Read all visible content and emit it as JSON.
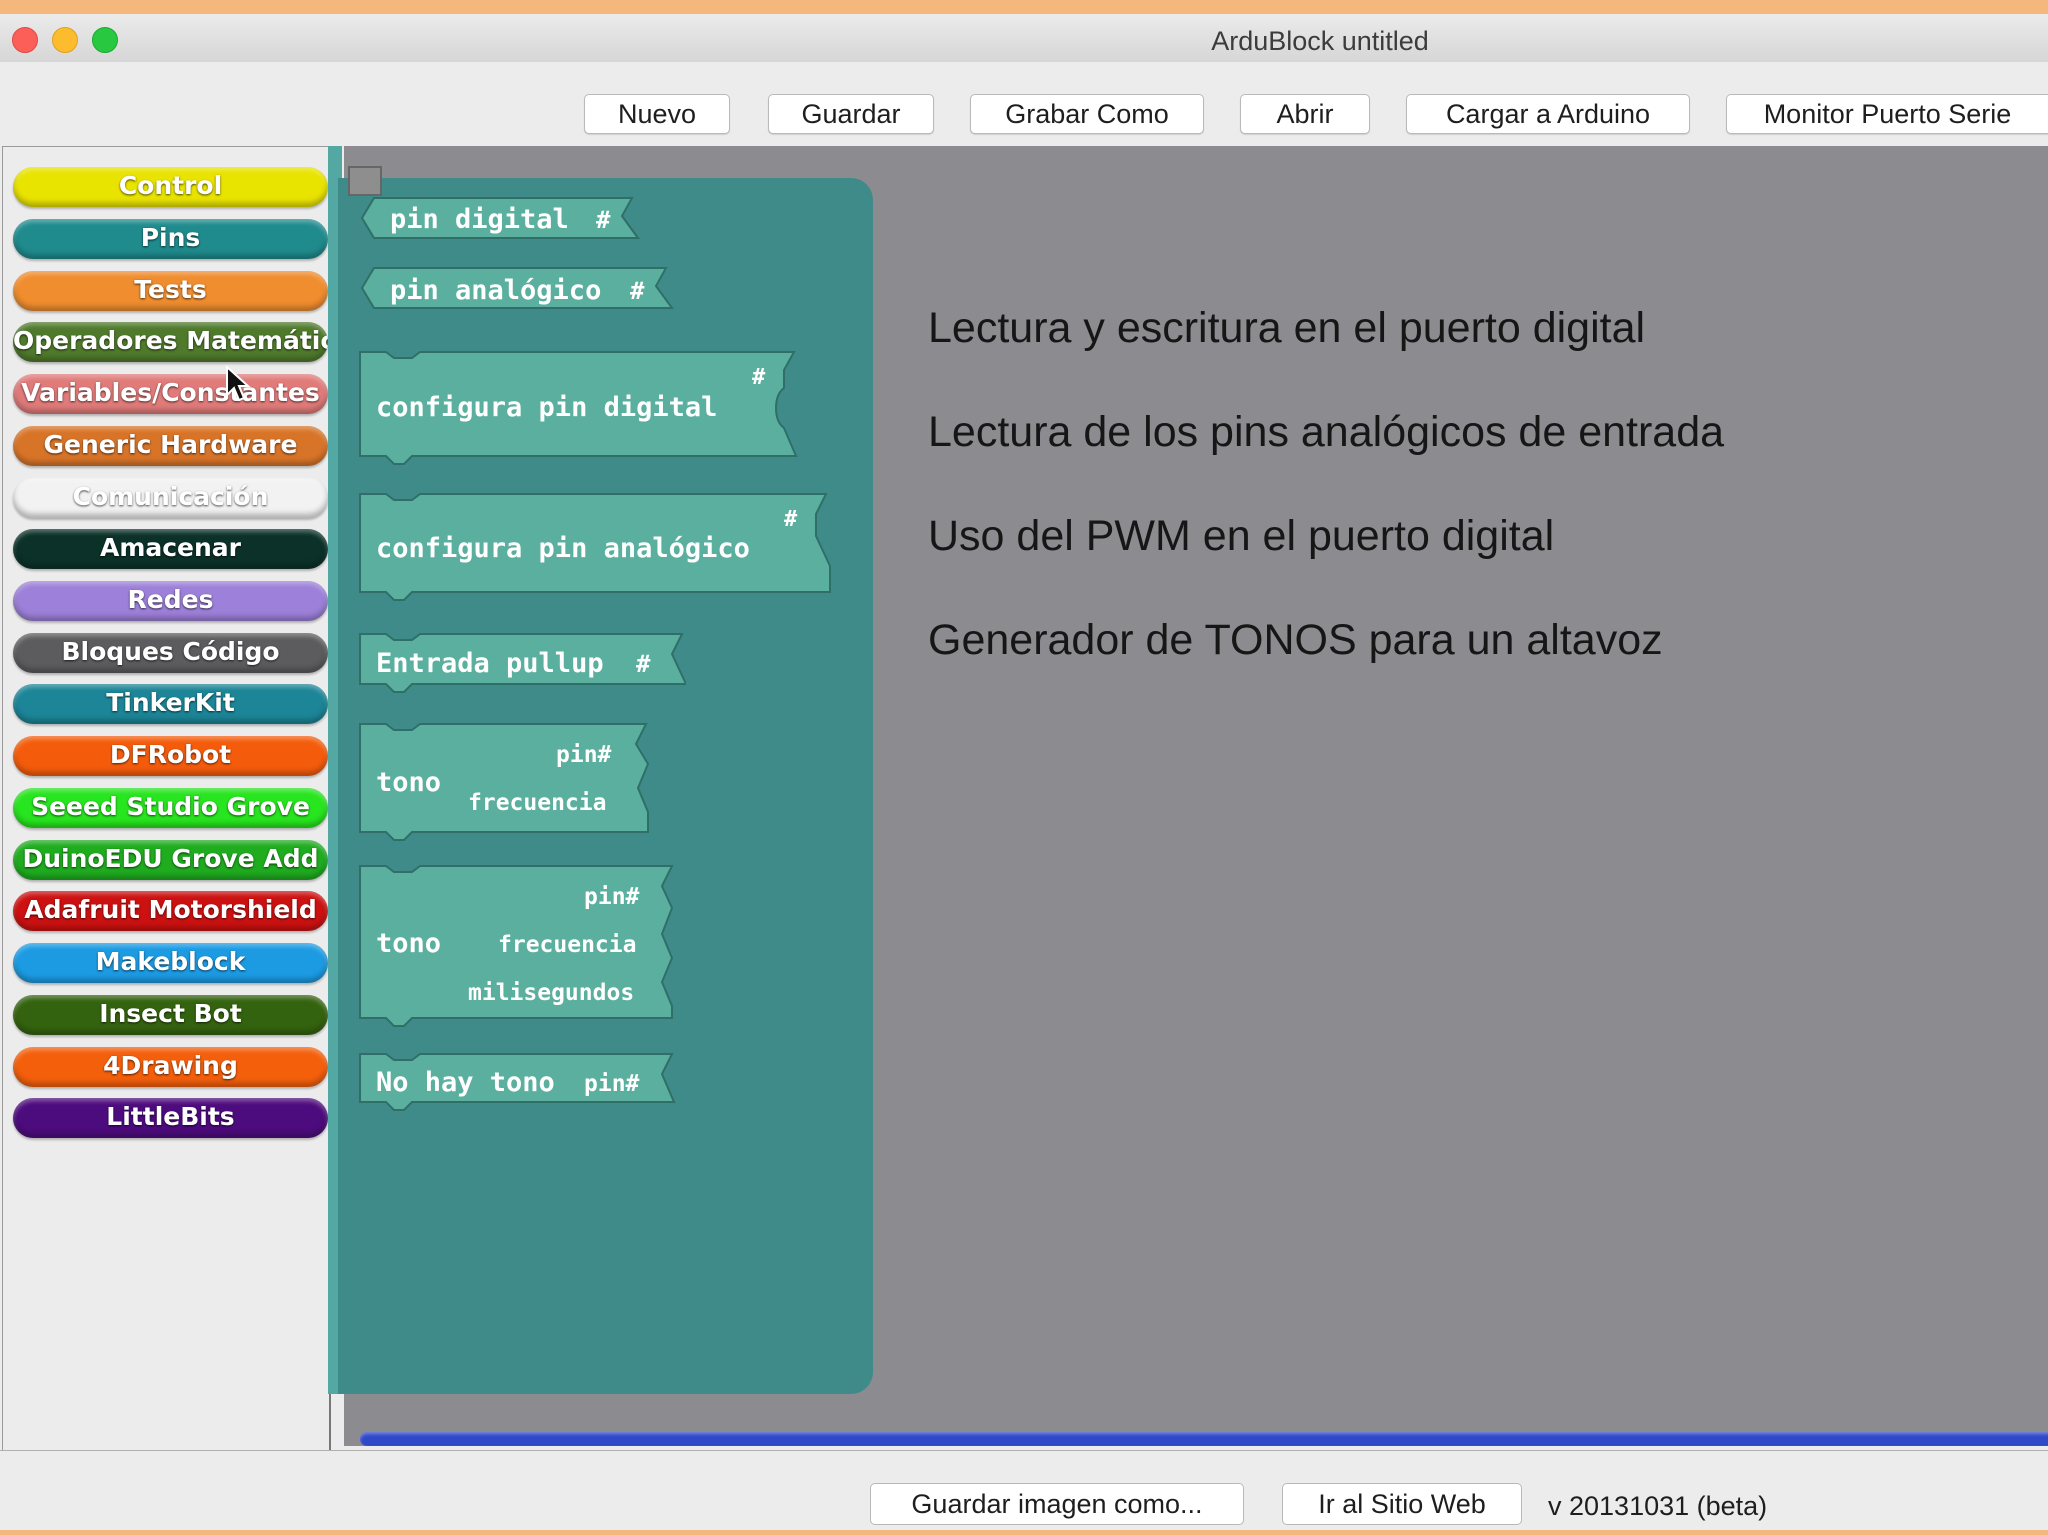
{
  "window": {
    "title": "ArduBlock untitled"
  },
  "toolbar": {
    "buttons": [
      "Nuevo",
      "Guardar",
      "Grabar Como",
      "Abrir",
      "Cargar a Arduino",
      "Monitor Puerto Serie"
    ]
  },
  "palette": {
    "categories": [
      {
        "label": "Control",
        "color": "#e9e300"
      },
      {
        "label": "Pins",
        "color": "#1f8b8d"
      },
      {
        "label": "Tests",
        "color": "#f08d2e"
      },
      {
        "label": "Operadores Matemáticos",
        "color": "#4f7a2c"
      },
      {
        "label": "Variables/Constantes",
        "color": "#e07b7a"
      },
      {
        "label": "Generic Hardware",
        "color": "#d87428"
      },
      {
        "label": "Comunicación",
        "color": "#f2f2f2"
      },
      {
        "label": "Amacenar",
        "color": "#0b3129"
      },
      {
        "label": "Redes",
        "color": "#9d80d9"
      },
      {
        "label": "Bloques Código",
        "color": "#5c5c5e"
      },
      {
        "label": "TinkerKit",
        "color": "#1c8597"
      },
      {
        "label": "DFRobot",
        "color": "#f45c0c"
      },
      {
        "label": "Seeed Studio Grove",
        "color": "#27e51e"
      },
      {
        "label": "DuinoEDU Grove Add",
        "color": "#1fac1f"
      },
      {
        "label": "Adafruit Motorshield",
        "color": "#cc1111"
      },
      {
        "label": "Makeblock",
        "color": "#1c9be3"
      },
      {
        "label": "Insect Bot",
        "color": "#34630f"
      },
      {
        "label": "4Drawing",
        "color": "#f45f0c"
      },
      {
        "label": "LittleBits",
        "color": "#4d0c7d"
      }
    ],
    "selected": "Pins"
  },
  "drawer": {
    "color": "#3f8b8a",
    "block_color": "#5baf9e",
    "blocks": {
      "pin_digital": {
        "label": "pin digital",
        "socket": "#"
      },
      "pin_analogico": {
        "label": "pin analógico",
        "socket": "#"
      },
      "configura_digital": {
        "label": "configura pin digital",
        "socket": "#"
      },
      "configura_analogico": {
        "label": "configura pin analógico",
        "socket": "#"
      },
      "entrada_pullup": {
        "label": "Entrada pullup",
        "socket": "#"
      },
      "tono1": {
        "label": "tono",
        "inputs": [
          "pin#",
          "frecuencia"
        ]
      },
      "tono2": {
        "label": "tono",
        "inputs": [
          "pin#",
          "frecuencia",
          "milisegundos"
        ]
      },
      "no_tono": {
        "label": "No hay tono",
        "input": "pin#"
      }
    }
  },
  "canvas": {
    "descriptions": [
      "Lectura y escritura en el puerto digital",
      "Lectura de los pins analógicos de entrada",
      "Uso del PWM en el puerto digital",
      "Generador de TONOS para un altavoz"
    ]
  },
  "bottombar": {
    "save_image": "Guardar imagen como...",
    "website": "Ir al Sitio Web",
    "version": "v 20131031 (beta)"
  }
}
